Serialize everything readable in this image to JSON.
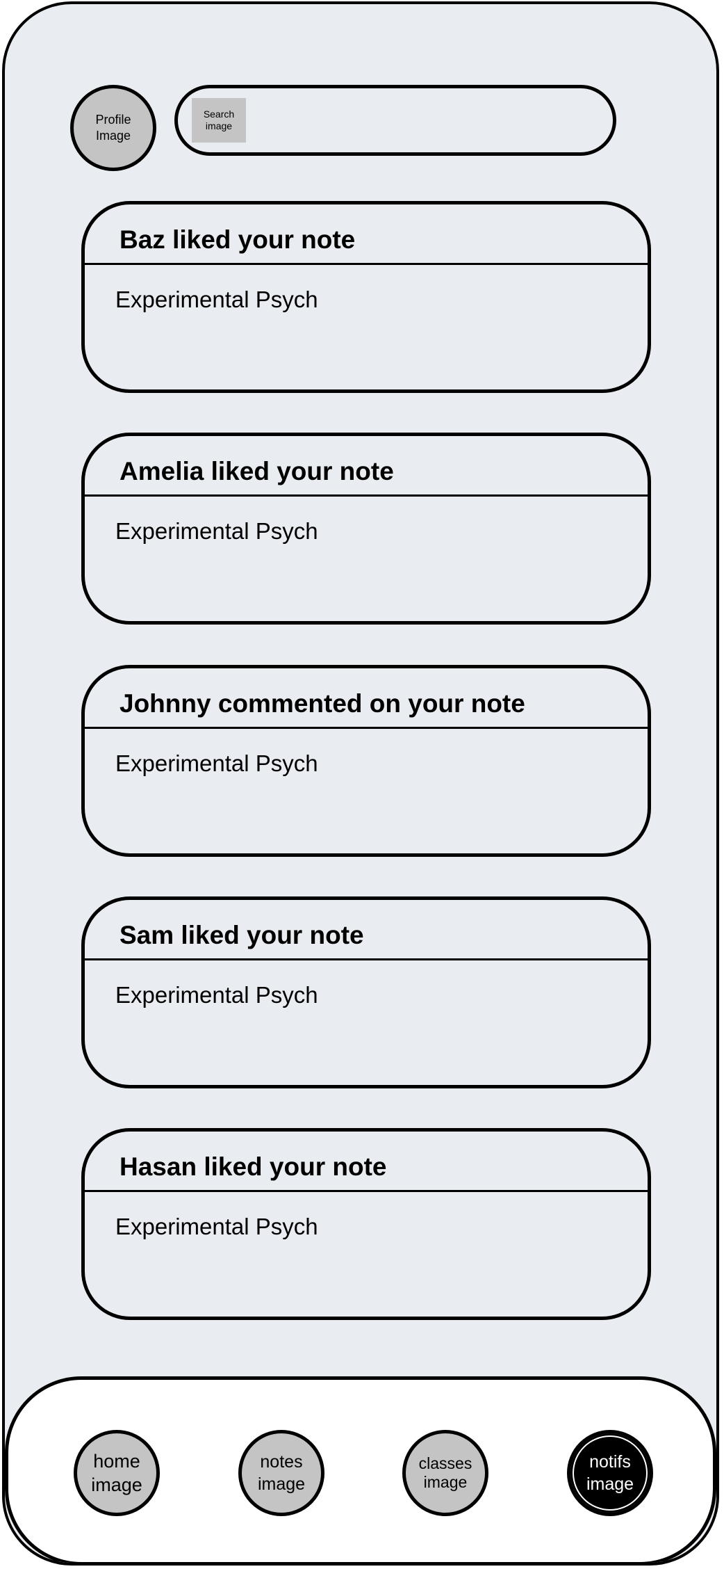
{
  "header": {
    "profile_label": "Profile\nImage",
    "search_label": "Search\nimage"
  },
  "notifications": [
    {
      "title": "Baz liked your note",
      "body": "Experimental Psych"
    },
    {
      "title": "Amelia liked your note",
      "body": "Experimental Psych"
    },
    {
      "title": "Johnny commented on your note",
      "body": "Experimental Psych"
    },
    {
      "title": "Sam liked your note",
      "body": "Experimental Psych"
    },
    {
      "title": "Hasan liked your note",
      "body": "Experimental Psych"
    }
  ],
  "nav": {
    "home": "home\nimage",
    "notes": "notes\nimage",
    "classes": "classes\nimage",
    "notifs": "notifs\nimage",
    "active": "notifs"
  },
  "colors": {
    "background": "#e9ecf0",
    "placeholder": "#c4c4c4",
    "active_nav": "#000000"
  }
}
